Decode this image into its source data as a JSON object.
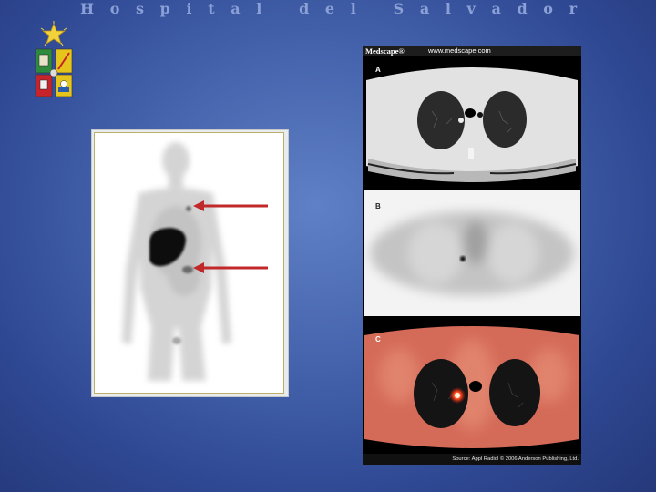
{
  "slide": {
    "title": "Hospital del Salvador"
  },
  "logo": {
    "icon": "university-crest-icon",
    "colors": [
      "#2e8a3c",
      "#e5c41c",
      "#c6232b",
      "#e5c41c"
    ]
  },
  "left_figure": {
    "description_icon": "whole-body-scan-icon",
    "arrow_color": "#c0282a",
    "arrow_count": 2
  },
  "medscape": {
    "brand": "Medscape®",
    "url": "www.medscape.com",
    "panels": [
      {
        "label": "A"
      },
      {
        "label": "B"
      },
      {
        "label": "C"
      }
    ],
    "source": "Source: Appl Radiol © 2006 Anderson Publishing, Ltd."
  }
}
